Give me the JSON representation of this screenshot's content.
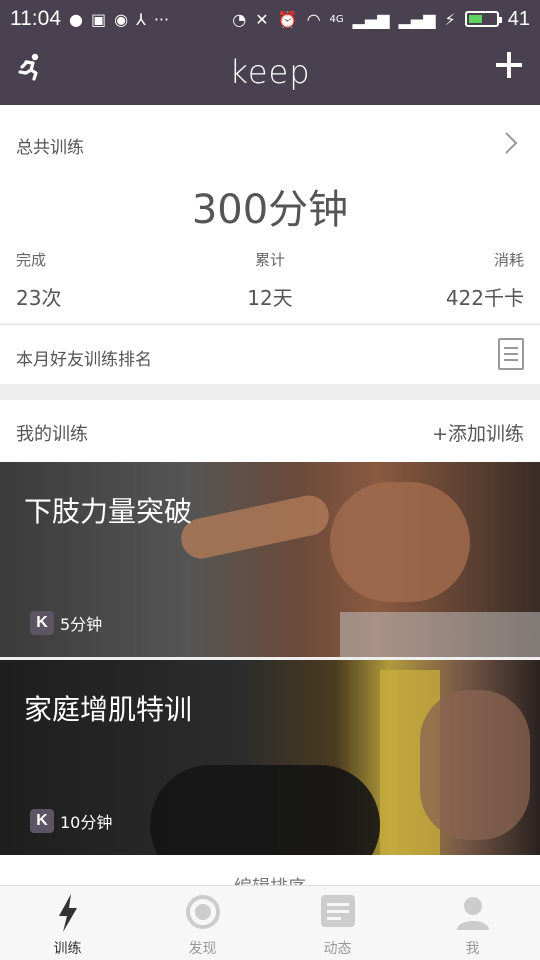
{
  "status_bar": {
    "time": "11:04",
    "battery_percent": "41",
    "battery_level": 0.41,
    "network": "4G"
  },
  "header": {
    "logo": "keep",
    "left_icon": "runner-icon",
    "right_icon": "plus-icon"
  },
  "summary": {
    "title": "总共训练",
    "total_value": "300分钟",
    "stats": [
      {
        "label": "完成",
        "value": "23次"
      },
      {
        "label": "累计",
        "value": "12天"
      },
      {
        "label": "消耗",
        "value": "422千卡"
      }
    ]
  },
  "ranking": {
    "label": "本月好友训练排名"
  },
  "my_training": {
    "title": "我的训练",
    "add_label": "+添加训练",
    "courses": [
      {
        "name": "下肢力量突破",
        "duration": "5分钟",
        "badge": "K"
      },
      {
        "name": "家庭增肌特训",
        "duration": "10分钟",
        "badge": "K"
      }
    ],
    "edit_label": "编辑排序"
  },
  "tabs": [
    {
      "label": "训练",
      "icon": "bolt-icon",
      "active": true
    },
    {
      "label": "发现",
      "icon": "target-icon",
      "active": false
    },
    {
      "label": "动态",
      "icon": "feed-icon",
      "active": false
    },
    {
      "label": "我",
      "icon": "person-icon",
      "active": false
    }
  ],
  "colors": {
    "header_bg": "#4a4150",
    "battery_fill": "#5fd35f"
  }
}
